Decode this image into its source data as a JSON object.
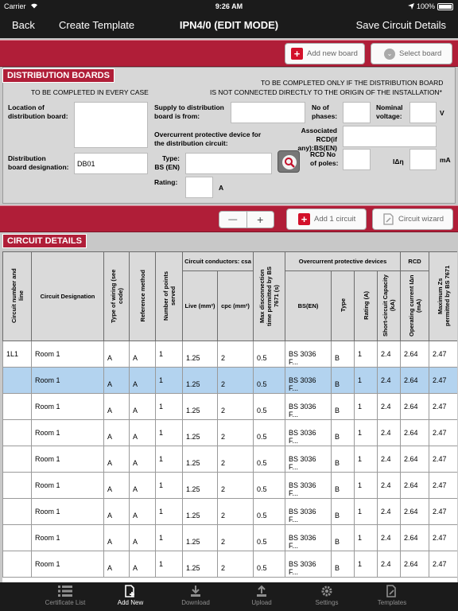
{
  "status": {
    "carrier": "Carrier",
    "time": "9:26 AM",
    "battery": "100%"
  },
  "nav": {
    "back": "Back",
    "create_template": "Create Template",
    "title": "IPN4/0 (EDIT MODE)",
    "save_circuit_details": "Save Circuit Details"
  },
  "toolbar": {
    "add_new_board": "Add new board",
    "select_board": "Select board"
  },
  "db": {
    "section_title": "DISTRIBUTION BOARDS",
    "every_case": "TO BE COMPLETED IN EVERY CASE",
    "only_if_1": "TO BE COMPLETED ONLY IF THE DISTRIBUTION BOARD",
    "only_if_2": "IS NOT CONNECTED DIRECTLY TO THE ORIGIN OF THE INSTALLATION*",
    "location_label_1": "Location of",
    "location_label_2": "distribution board:",
    "supply_label_1": "Supply to distribution",
    "supply_label_2": "board is from:",
    "phases_label_1": "No of",
    "phases_label_2": "phases:",
    "nominal_label_1": "Nominal",
    "nominal_label_2": "voltage:",
    "volt_unit": "V",
    "ocpd_label_1": "Overcurrent protective device for",
    "ocpd_label_2": "the distribution circuit:",
    "assoc_label_1": "Associated",
    "assoc_label_2": "RCD(if any):BS(EN)",
    "designation_label_1": "Distribution",
    "designation_label_2": "board designation:",
    "designation_value": "DB01",
    "type_label_1": "Type:",
    "type_label_2": "BS (EN)",
    "rcd_poles_label_1": "RCD No",
    "rcd_poles_label_2": "of poles:",
    "idn_label": "IΔη",
    "ma_unit": "mA",
    "rating_label": "Rating:",
    "amp_unit": "A"
  },
  "circuit_toolbar": {
    "minus": "—",
    "plus": "+",
    "add_circuit": "Add 1 circuit",
    "circuit_wizard": "Circuit wizard"
  },
  "circuits": {
    "section_title": "CIRCUIT DETAILS",
    "headers": {
      "circuit_number": "Circuit number and line",
      "designation": "Circuit Designation",
      "wiring": "Type of wiring (see code)",
      "ref_method": "Reference method",
      "points": "Number of points served",
      "conductors": "Circuit conductors: csa",
      "live": "Live (mm²)",
      "cpc": "cpc (mm²)",
      "max_disc": "Max disconnection time permitted by BS 7671 (s)",
      "ocpd": "Overcurrent protective devices",
      "bs": "BS(EN)",
      "type": "Type",
      "rating": "Rating (A)",
      "short_circuit": "Short-circuit Capacity (kA)",
      "rcd": "RCD",
      "operating": "Operating current IΔn (mA)",
      "max_zs": "Maximum Zs permitted by BS 7671"
    },
    "rows": [
      {
        "num": "1L1",
        "designation": "Room 1",
        "wiring": "A",
        "ref": "A",
        "points": "1",
        "live": "1.25",
        "cpc": "2",
        "disc": "0.5",
        "bs": "BS 3036 F...",
        "type": "B",
        "rating": "1",
        "sc": "2.4",
        "op": "2.64",
        "zs": "2.47"
      },
      {
        "num": "",
        "designation": "Room 1",
        "wiring": "A",
        "ref": "A",
        "points": "1",
        "live": "1.25",
        "cpc": "2",
        "disc": "0.5",
        "bs": "BS 3036 F...",
        "type": "B",
        "rating": "1",
        "sc": "2.4",
        "op": "2.64",
        "zs": "2.47"
      },
      {
        "num": "",
        "designation": "Room 1",
        "wiring": "A",
        "ref": "A",
        "points": "1",
        "live": "1.25",
        "cpc": "2",
        "disc": "0.5",
        "bs": "BS 3036 F...",
        "type": "B",
        "rating": "1",
        "sc": "2.4",
        "op": "2.64",
        "zs": "2.47"
      },
      {
        "num": "",
        "designation": "Room 1",
        "wiring": "A",
        "ref": "A",
        "points": "1",
        "live": "1.25",
        "cpc": "2",
        "disc": "0.5",
        "bs": "BS 3036 F...",
        "type": "B",
        "rating": "1",
        "sc": "2.4",
        "op": "2.64",
        "zs": "2.47"
      },
      {
        "num": "",
        "designation": "Room 1",
        "wiring": "A",
        "ref": "A",
        "points": "1",
        "live": "1.25",
        "cpc": "2",
        "disc": "0.5",
        "bs": "BS 3036 F...",
        "type": "B",
        "rating": "1",
        "sc": "2.4",
        "op": "2.64",
        "zs": "2.47"
      },
      {
        "num": "",
        "designation": "Room 1",
        "wiring": "A",
        "ref": "A",
        "points": "1",
        "live": "1.25",
        "cpc": "2",
        "disc": "0.5",
        "bs": "BS 3036 F...",
        "type": "B",
        "rating": "1",
        "sc": "2.4",
        "op": "2.64",
        "zs": "2.47"
      },
      {
        "num": "",
        "designation": "Room 1",
        "wiring": "A",
        "ref": "A",
        "points": "1",
        "live": "1.25",
        "cpc": "2",
        "disc": "0.5",
        "bs": "BS 3036 F...",
        "type": "B",
        "rating": "1",
        "sc": "2.4",
        "op": "2.64",
        "zs": "2.47"
      },
      {
        "num": "",
        "designation": "Room 1",
        "wiring": "A",
        "ref": "A",
        "points": "1",
        "live": "1.25",
        "cpc": "2",
        "disc": "0.5",
        "bs": "BS 3036 F...",
        "type": "B",
        "rating": "1",
        "sc": "2.4",
        "op": "2.64",
        "zs": "2.47"
      },
      {
        "num": "",
        "designation": "Room 1",
        "wiring": "A",
        "ref": "A",
        "points": "1",
        "live": "1.25",
        "cpc": "2",
        "disc": "0.5",
        "bs": "BS 3036 F...",
        "type": "B",
        "rating": "1",
        "sc": "2.4",
        "op": "2.64",
        "zs": "2.47"
      }
    ]
  },
  "tabbar": {
    "certificate_list": "Certificate List",
    "add_new": "Add New",
    "download": "Download",
    "upload": "Upload",
    "settings": "Settings",
    "templates": "Templates"
  }
}
